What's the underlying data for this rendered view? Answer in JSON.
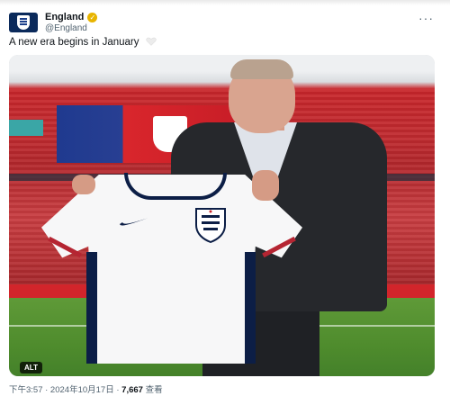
{
  "account": {
    "display_name": "England",
    "handle": "@England",
    "verified_icon": "gold-check-icon",
    "avatar_icon": "england-crest-avatar-icon"
  },
  "tweet": {
    "text": "A new era begins in January",
    "emoji_icon": "white-heart-icon"
  },
  "media": {
    "alt_label": "ALT"
  },
  "meta": {
    "time_date": "下午3:57 · 2024年10月17日 · ",
    "views_count": "7,667",
    "views_label": " 查看"
  },
  "more_menu": "···",
  "colors": {
    "accent_gold": "#e8b400",
    "navy": "#0c1e46",
    "red": "#c8262b"
  }
}
